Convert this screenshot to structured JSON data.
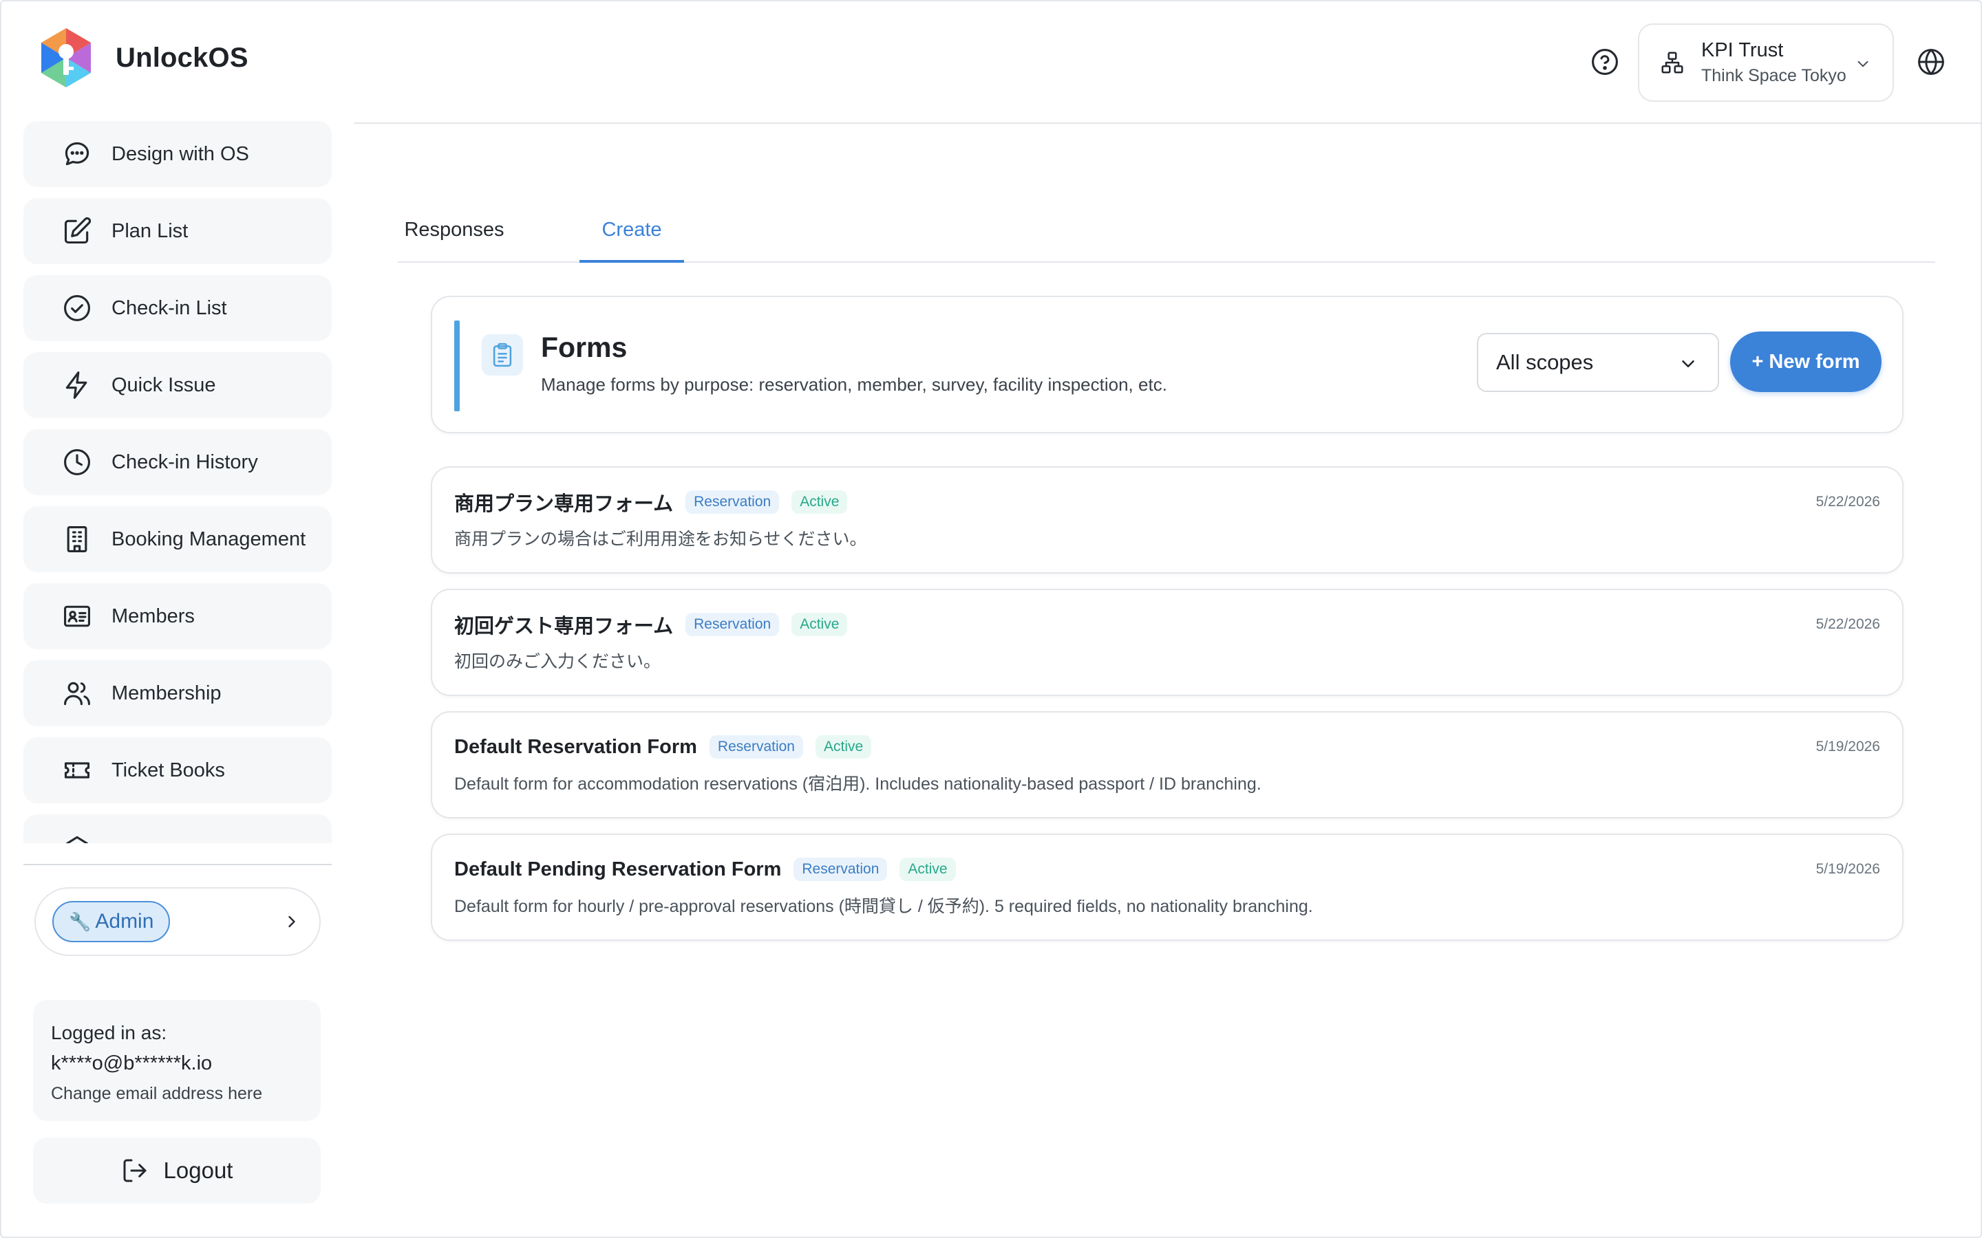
{
  "brand": {
    "name": "UnlockOS"
  },
  "sidebar": {
    "items": [
      {
        "label": "Design with OS",
        "icon": "chat-bubble-icon"
      },
      {
        "label": "Plan List",
        "icon": "edit-icon"
      },
      {
        "label": "Check-in List",
        "icon": "check-circle-icon"
      },
      {
        "label": "Quick Issue",
        "icon": "lightning-icon"
      },
      {
        "label": "Check-in History",
        "icon": "clock-icon"
      },
      {
        "label": "Booking Management",
        "icon": "building-icon"
      },
      {
        "label": "Members",
        "icon": "id-card-icon"
      },
      {
        "label": "Membership",
        "icon": "users-icon"
      },
      {
        "label": "Ticket Books",
        "icon": "ticket-icon"
      }
    ],
    "admin": {
      "label": "Admin",
      "icon": "wrench-icon"
    },
    "login": {
      "caption": "Logged in as:",
      "email": "k****o@b******k.io",
      "change_label": "Change email address here"
    },
    "logout_label": "Logout"
  },
  "header": {
    "org_name": "KPI Trust",
    "org_sub": "Think Space Tokyo"
  },
  "tabs": [
    {
      "label": "Responses",
      "active": false
    },
    {
      "label": "Create",
      "active": true
    }
  ],
  "forms_panel": {
    "title": "Forms",
    "description": "Manage forms by purpose: reservation, member, survey, facility inspection, etc.",
    "scope_selected": "All scopes",
    "new_button": "+ New form"
  },
  "forms": [
    {
      "title": "商用プラン専用フォーム",
      "type": "Reservation",
      "status": "Active",
      "description": "商用プランの場合はご利用用途をお知らせください。",
      "date": "5/22/2026"
    },
    {
      "title": "初回ゲスト専用フォーム",
      "type": "Reservation",
      "status": "Active",
      "description": "初回のみご入力ください。",
      "date": "5/22/2026"
    },
    {
      "title": "Default Reservation Form",
      "type": "Reservation",
      "status": "Active",
      "description": "Default form for accommodation reservations (宿泊用). Includes nationality-based passport / ID branching.",
      "date": "5/19/2026"
    },
    {
      "title": "Default Pending Reservation Form",
      "type": "Reservation",
      "status": "Active",
      "description": "Default form for hourly / pre-approval reservations (時間貸し / 仮予約). 5 required fields, no nationality branching.",
      "date": "5/19/2026"
    }
  ],
  "colors": {
    "accent": "#3b82d9",
    "badge_type": "#3b7dc4",
    "badge_status": "#27a88a"
  }
}
